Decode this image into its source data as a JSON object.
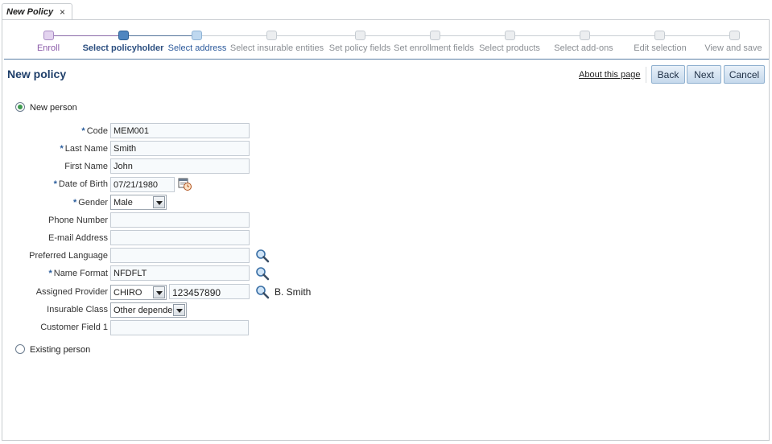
{
  "tab": {
    "title": "New Policy",
    "close": "×"
  },
  "train": {
    "steps": [
      {
        "label": "Enroll",
        "state": "visited"
      },
      {
        "label": "Select policyholder",
        "state": "current"
      },
      {
        "label": "Select address",
        "state": "next"
      },
      {
        "label": "Select insurable entities",
        "state": "disabled"
      },
      {
        "label": "Set policy fields",
        "state": "disabled"
      },
      {
        "label": "Set enrollment fields",
        "state": "disabled"
      },
      {
        "label": "Select products",
        "state": "disabled"
      },
      {
        "label": "Select add-ons",
        "state": "disabled"
      },
      {
        "label": "Edit selection",
        "state": "disabled"
      },
      {
        "label": "View and save",
        "state": "disabled"
      }
    ]
  },
  "page": {
    "title": "New policy",
    "about_link": "About this page"
  },
  "buttons": {
    "back": "Back",
    "next": "Next",
    "cancel": "Cancel"
  },
  "choice": {
    "new_person": {
      "label": "New person",
      "selected": true
    },
    "existing_person": {
      "label": "Existing person",
      "selected": false
    }
  },
  "form": {
    "code": {
      "label": "Code",
      "required": true,
      "value": "MEM001"
    },
    "last_name": {
      "label": "Last Name",
      "required": true,
      "value": "Smith"
    },
    "first_name": {
      "label": "First Name",
      "required": false,
      "value": "John"
    },
    "date_of_birth": {
      "label": "Date of Birth",
      "required": true,
      "value": "07/21/1980"
    },
    "gender": {
      "label": "Gender",
      "required": true,
      "value": "Male"
    },
    "phone_number": {
      "label": "Phone Number",
      "required": false,
      "value": ""
    },
    "email_address": {
      "label": "E-mail Address",
      "required": false,
      "value": ""
    },
    "preferred_language": {
      "label": "Preferred Language",
      "required": false,
      "value": ""
    },
    "name_format": {
      "label": "Name Format",
      "required": true,
      "value": "NFDFLT"
    },
    "assigned_provider": {
      "label": "Assigned Provider",
      "required": false,
      "type_value": "CHIRO",
      "code_value": "123457890",
      "provider_name": "B. Smith"
    },
    "insurable_class": {
      "label": "Insurable Class",
      "required": false,
      "value": "Other depende"
    },
    "customer_field_1": {
      "label": "Customer Field 1",
      "required": false,
      "value": ""
    }
  },
  "required_marker": "*",
  "icons": {
    "search": "search-icon",
    "calendar": "calendar-icon",
    "radio": "radio-icon",
    "dropdown": "chevron-down-icon"
  },
  "colors": {
    "accent": "#2c4f80",
    "visited": "#8a5aa8",
    "current_step": "#4f86c0",
    "button_border": "#8fb0cf",
    "radio_selected": "#3f9a50"
  }
}
